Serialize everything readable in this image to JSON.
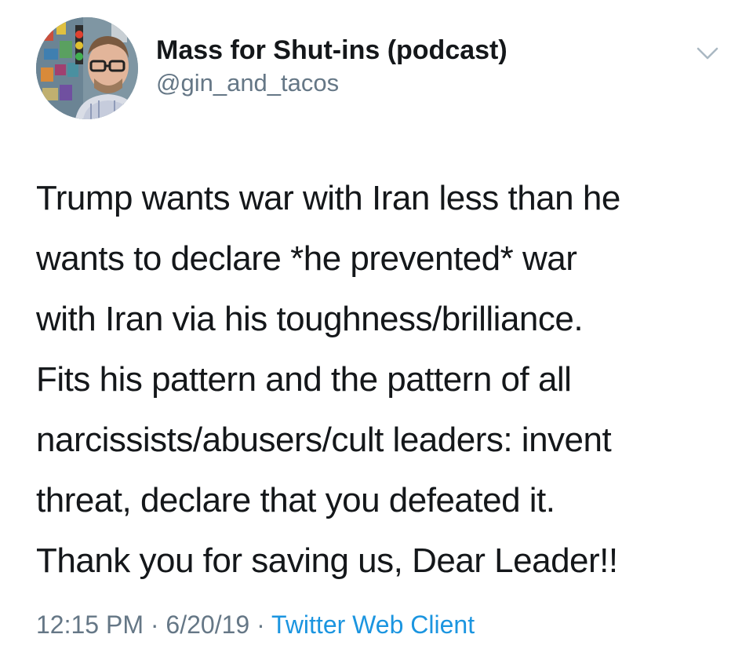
{
  "author": {
    "display_name": "Mass for Shut-ins (podcast)",
    "handle": "@gin_and_tacos",
    "avatar_icon": "profile-photo"
  },
  "menu": {
    "icon": "chevron-down-icon"
  },
  "tweet": {
    "lines": [
      "Trump wants war with Iran less than he",
      "wants to declare *he prevented* war",
      "with Iran via his toughness/brilliance.",
      "Fits his pattern and the pattern of all",
      "narcissists/abusers/cult leaders: invent",
      "threat, declare that you defeated it.",
      "Thank you for saving us, Dear Leader!!"
    ]
  },
  "meta": {
    "time": "12:15 PM",
    "separator": "·",
    "date": "6/20/19",
    "source": "Twitter Web Client"
  },
  "colors": {
    "text": "#14171a",
    "secondary": "#657786",
    "link": "#1b95e0",
    "chevron": "#aab8c2"
  }
}
